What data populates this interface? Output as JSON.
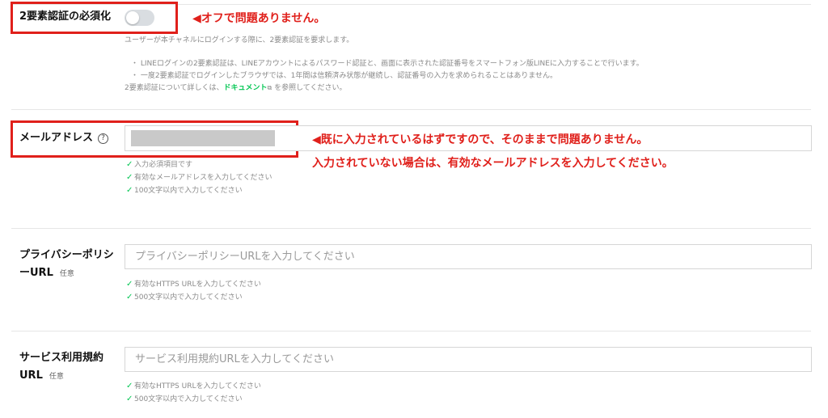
{
  "two_factor": {
    "label": "2要素認証の必須化",
    "description": "ユーザーが本チャネルにログインする際に、2要素認証を要求します。",
    "notes": [
      "・ LINEログインの2要素認証は、LINEアカウントによるパスワード認証と、画面に表示された認証番号をスマートフォン版LINEに入力することで行います。",
      "・ 一度2要素認証でログインしたブラウザでは、1年間は信頼済み状態が継続し、認証番号の入力を求められることはありません。"
    ],
    "doc_prefix": "2要素認証について詳しくは、",
    "doc_link": "ドキュメント",
    "doc_suffix": " を参照してください。",
    "toggle_state": "off"
  },
  "annotations": {
    "toggle_note": "◀オフで問題ありません。",
    "email_note_1": "◀既に入力されているはずですので、そのままで問題ありません。",
    "email_note_2": "入力されていない場合は、有効なメールアドレスを入力してください。"
  },
  "email": {
    "label": "メールアドレス",
    "help_icon": "?",
    "validations": [
      "入力必須項目です",
      "有効なメールアドレスを入力してください",
      "100文字以内で入力してください"
    ]
  },
  "privacy": {
    "label_line1": "プライバシーポリシ",
    "label_line2": "ーURL",
    "optional": "任意",
    "placeholder": "プライバシーポリシーURLを入力してください",
    "validations": [
      "有効なHTTPS URLを入力してください",
      "500文字以内で入力してください"
    ]
  },
  "terms": {
    "label_line1": "サービス利用規約",
    "label_line2": "URL",
    "optional": "任意",
    "placeholder": "サービス利用規約URLを入力してください",
    "validations": [
      "有効なHTTPS URLを入力してください",
      "500文字以内で入力してください"
    ]
  },
  "colors": {
    "annotation_red": "#e0201b",
    "check_green": "#06c755",
    "link_green": "#06c755"
  },
  "icons": {
    "check": "check-icon",
    "help": "help-circle-icon",
    "external": "external-link-icon"
  }
}
